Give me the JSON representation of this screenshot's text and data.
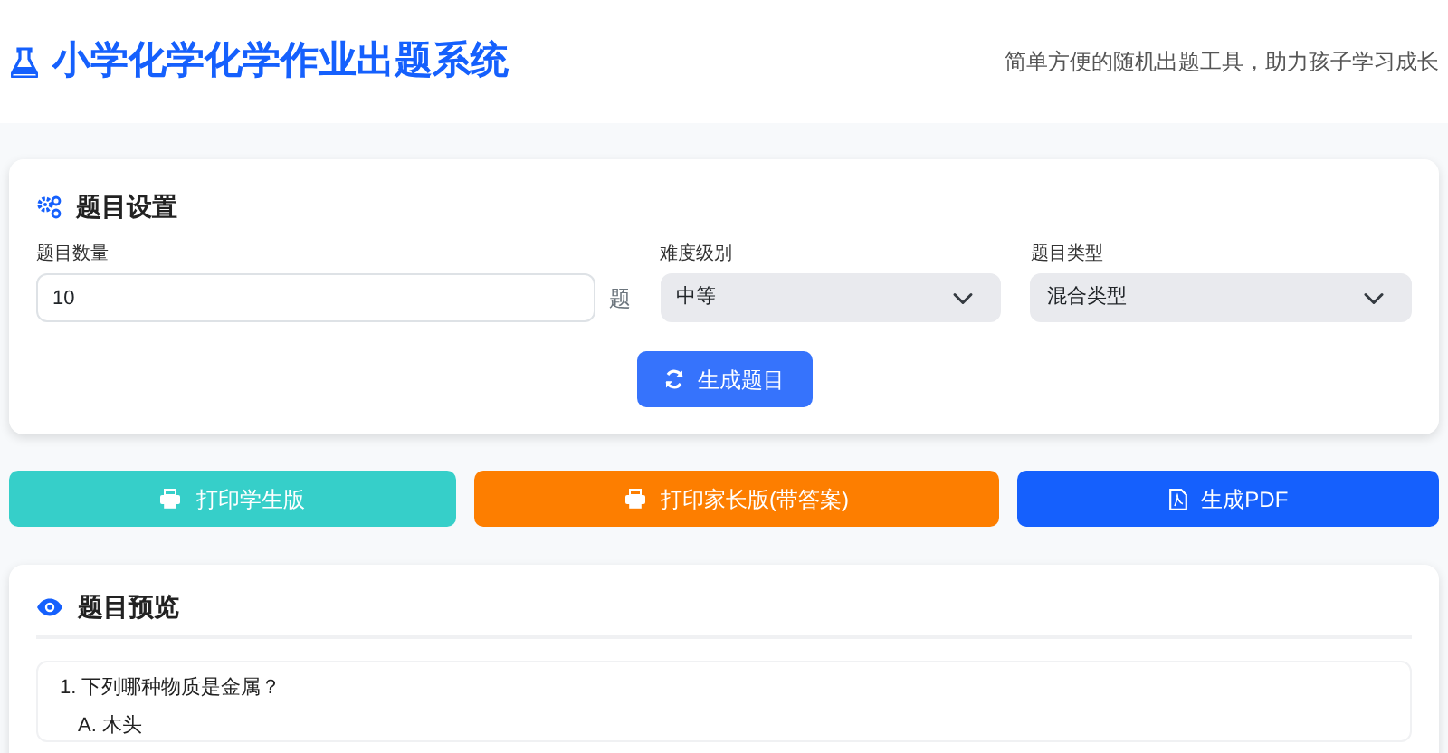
{
  "header": {
    "title": "小学化学化学作业出题系统",
    "subtitle": "简单方便的随机出题工具，助力孩子学习成长"
  },
  "settings": {
    "heading": "题目设置",
    "count": {
      "label": "题目数量",
      "value": "10",
      "unit": "题"
    },
    "difficulty": {
      "label": "难度级别",
      "value": "中等"
    },
    "type": {
      "label": "题目类型",
      "value": "混合类型"
    },
    "generate_button": "生成题目"
  },
  "actions": [
    {
      "label": "打印学生版",
      "kind": "print",
      "color": "#36cfc9"
    },
    {
      "label": "打印家长版(带答案)",
      "kind": "print",
      "color": "#fd7e00"
    },
    {
      "label": "生成PDF",
      "kind": "pdf",
      "color": "#1560fd"
    }
  ],
  "preview": {
    "heading": "题目预览",
    "questions": [
      {
        "text": "1. 下列哪种物质是金属？",
        "options": [
          "A. 木头"
        ]
      }
    ]
  }
}
